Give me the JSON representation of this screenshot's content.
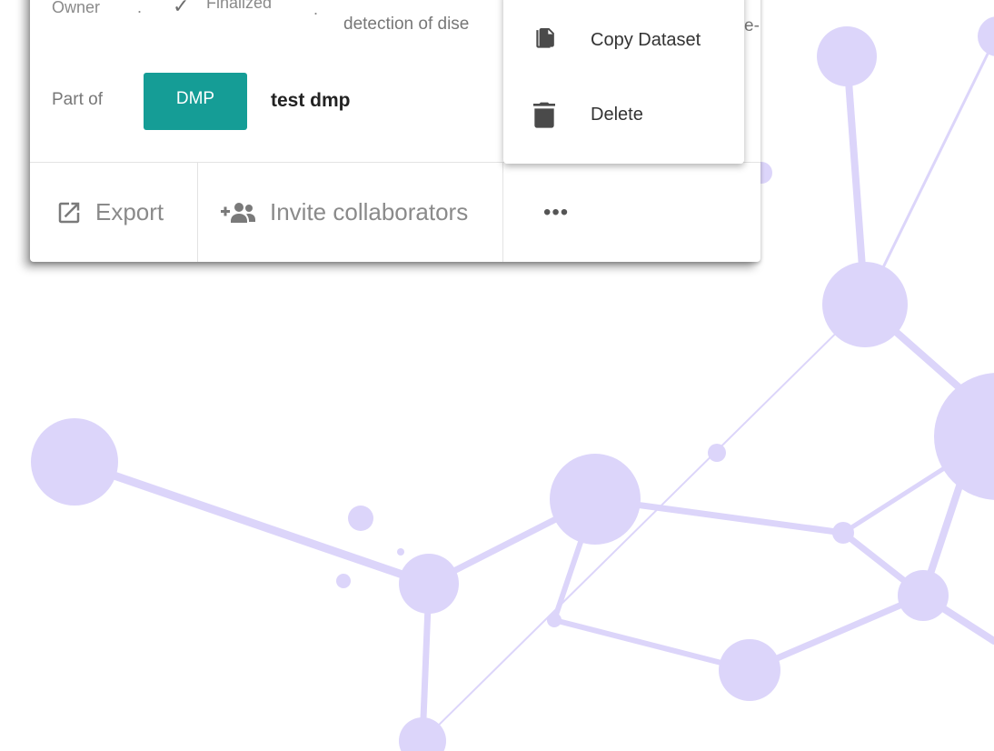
{
  "card": {
    "owner_label": "Owner",
    "separator_1": ".",
    "status_label": "Finalized",
    "separator_2": ".",
    "description_fragment": "detection of dise",
    "description_tail": "e-",
    "part_of_label": "Part of",
    "dmp_badge": "DMP",
    "dmp_name": "test dmp",
    "actions": {
      "export_label": "Export",
      "invite_label": "Invite collaborators",
      "more_label": "•••"
    }
  },
  "menu": {
    "items": [
      {
        "label": "Copy Dataset",
        "icon": "copy-icon"
      },
      {
        "label": "Delete",
        "icon": "delete-icon"
      }
    ]
  },
  "colors": {
    "accent": "#159d96",
    "background_network": "#dcd5fa"
  }
}
